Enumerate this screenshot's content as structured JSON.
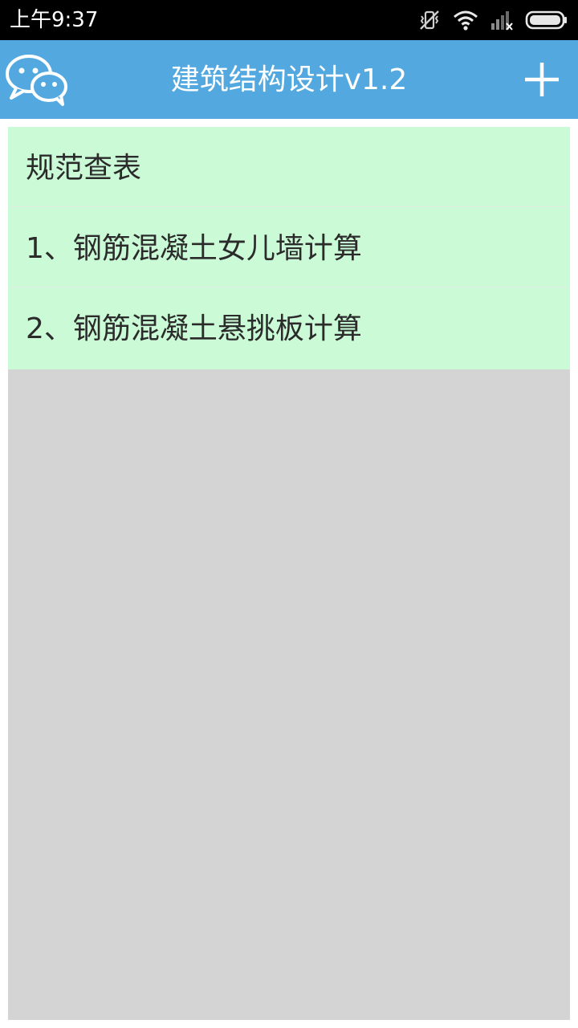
{
  "status_bar": {
    "time": "上午9:37",
    "icons": [
      "vibrate-off-icon",
      "wifi-icon",
      "signal-icon",
      "battery-icon"
    ]
  },
  "app_bar": {
    "title": "建筑结构设计v1.2",
    "logo_icon": "wechat-logo-icon",
    "action_icon": "plus-icon",
    "background_color": "#53a9df"
  },
  "menu": {
    "items": [
      {
        "label": "规范查表"
      },
      {
        "label": "1、钢筋混凝土女儿墙计算"
      },
      {
        "label": "2、钢筋混凝土悬挑板计算"
      }
    ],
    "item_background_color": "#cbfbd6",
    "content_background_color": "#d4d4d4"
  }
}
